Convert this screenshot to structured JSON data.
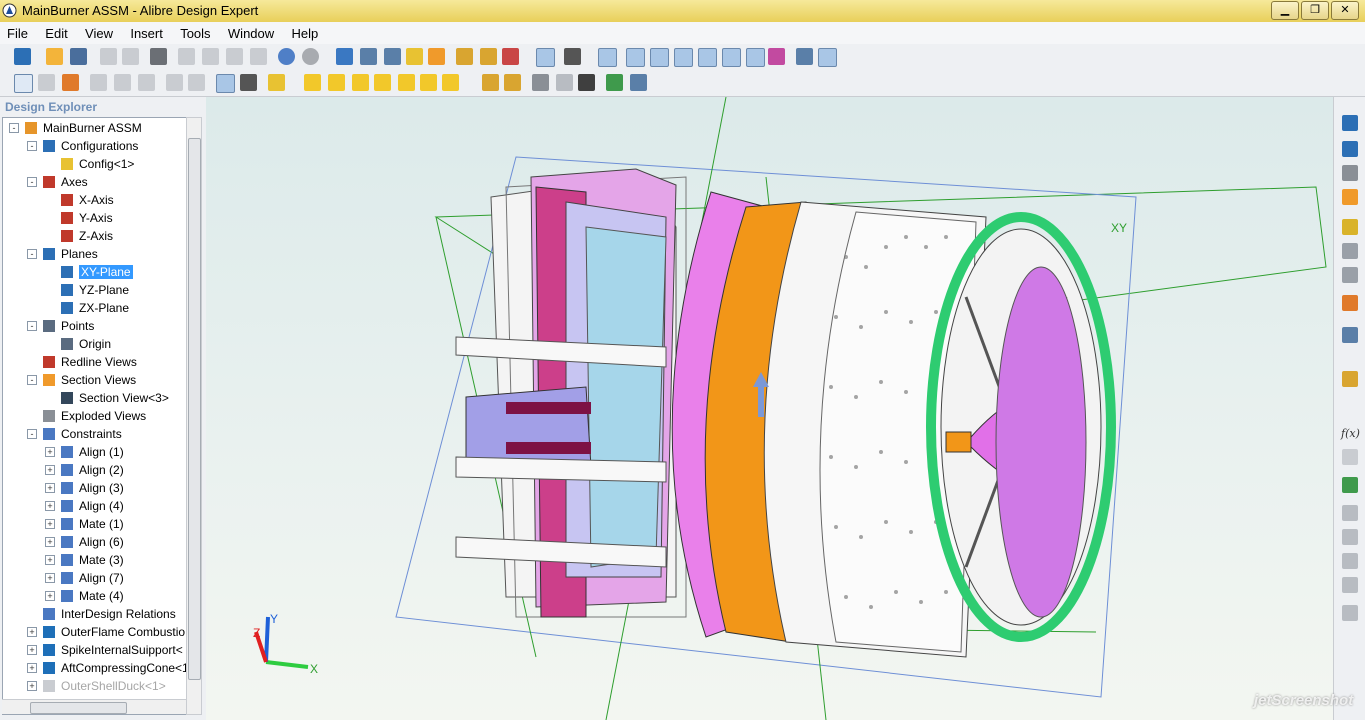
{
  "window": {
    "title": "MainBurner ASSM - Alibre Design Expert",
    "controls": [
      "minimize",
      "restore",
      "close"
    ]
  },
  "menu": [
    "File",
    "Edit",
    "View",
    "Insert",
    "Tools",
    "Window",
    "Help"
  ],
  "explorer": {
    "header": "Design Explorer",
    "tree": [
      {
        "label": "MainBurner ASSM",
        "level": 0,
        "icon": "assembly-icon",
        "expander": "-"
      },
      {
        "label": "Configurations",
        "level": 1,
        "icon": "configurations-icon",
        "expander": "-"
      },
      {
        "label": "Config<1>",
        "level": 2,
        "icon": "config-icon",
        "expander": ""
      },
      {
        "label": "Axes",
        "level": 1,
        "icon": "axes-icon",
        "expander": "-"
      },
      {
        "label": "X-Axis",
        "level": 2,
        "icon": "axis-icon",
        "expander": ""
      },
      {
        "label": "Y-Axis",
        "level": 2,
        "icon": "axis-icon",
        "expander": ""
      },
      {
        "label": "Z-Axis",
        "level": 2,
        "icon": "axis-icon",
        "expander": ""
      },
      {
        "label": "Planes",
        "level": 1,
        "icon": "planes-icon",
        "expander": "-"
      },
      {
        "label": "XY-Plane",
        "level": 2,
        "icon": "plane-icon",
        "expander": "",
        "selected": true
      },
      {
        "label": "YZ-Plane",
        "level": 2,
        "icon": "plane-icon",
        "expander": ""
      },
      {
        "label": "ZX-Plane",
        "level": 2,
        "icon": "plane-icon",
        "expander": ""
      },
      {
        "label": "Points",
        "level": 1,
        "icon": "points-icon",
        "expander": "-"
      },
      {
        "label": "Origin",
        "level": 2,
        "icon": "point-icon",
        "expander": ""
      },
      {
        "label": "Redline Views",
        "level": 1,
        "icon": "redline-icon",
        "expander": ""
      },
      {
        "label": "Section Views",
        "level": 1,
        "icon": "section-views-icon",
        "expander": "-"
      },
      {
        "label": "Section View<3>",
        "level": 2,
        "icon": "section-view-icon",
        "expander": ""
      },
      {
        "label": "Exploded Views",
        "level": 1,
        "icon": "exploded-views-icon",
        "expander": ""
      },
      {
        "label": "Constraints",
        "level": 1,
        "icon": "constraints-icon",
        "expander": "-"
      },
      {
        "label": "Align (1)",
        "level": 2,
        "icon": "constraint-icon",
        "expander": "+"
      },
      {
        "label": "Align (2)",
        "level": 2,
        "icon": "constraint-icon",
        "expander": "+"
      },
      {
        "label": "Align (3)",
        "level": 2,
        "icon": "constraint-icon",
        "expander": "+"
      },
      {
        "label": "Align (4)",
        "level": 2,
        "icon": "constraint-icon",
        "expander": "+"
      },
      {
        "label": "Mate (1)",
        "level": 2,
        "icon": "constraint-icon",
        "expander": "+"
      },
      {
        "label": "Align (6)",
        "level": 2,
        "icon": "constraint-icon",
        "expander": "+"
      },
      {
        "label": "Mate (3)",
        "level": 2,
        "icon": "constraint-icon",
        "expander": "+"
      },
      {
        "label": "Align (7)",
        "level": 2,
        "icon": "constraint-icon",
        "expander": "+"
      },
      {
        "label": "Mate (4)",
        "level": 2,
        "icon": "constraint-icon",
        "expander": "+"
      },
      {
        "label": "InterDesign Relations",
        "level": 1,
        "icon": "relations-icon",
        "expander": ""
      },
      {
        "label": "OuterFlame Combustio",
        "level": 1,
        "icon": "part-icon",
        "expander": "+"
      },
      {
        "label": "SpikeInternalSuipport<",
        "level": 1,
        "icon": "part-icon",
        "expander": "+"
      },
      {
        "label": "AftCompressingCone<1",
        "level": 1,
        "icon": "part-icon",
        "expander": "+"
      },
      {
        "label": "OuterShellDuck<1>",
        "level": 1,
        "icon": "part-hidden-icon",
        "expander": "+",
        "disabled": true
      }
    ]
  },
  "viewport": {
    "plane_label": "XY",
    "triad": {
      "x": "X",
      "y": "Y",
      "z": "Z"
    }
  },
  "right_toolbar": {
    "fx_label": "f(x)"
  },
  "watermark": "jetScreenshot",
  "colors": {
    "titlebar": "#e8cf5a",
    "selection": "#3399ff",
    "plane_lines": "#2e9e2e",
    "magenta": "#e87fe8",
    "orange": "#f29618",
    "green_ring": "#2ecc71",
    "lavender": "#a5a2e8"
  }
}
